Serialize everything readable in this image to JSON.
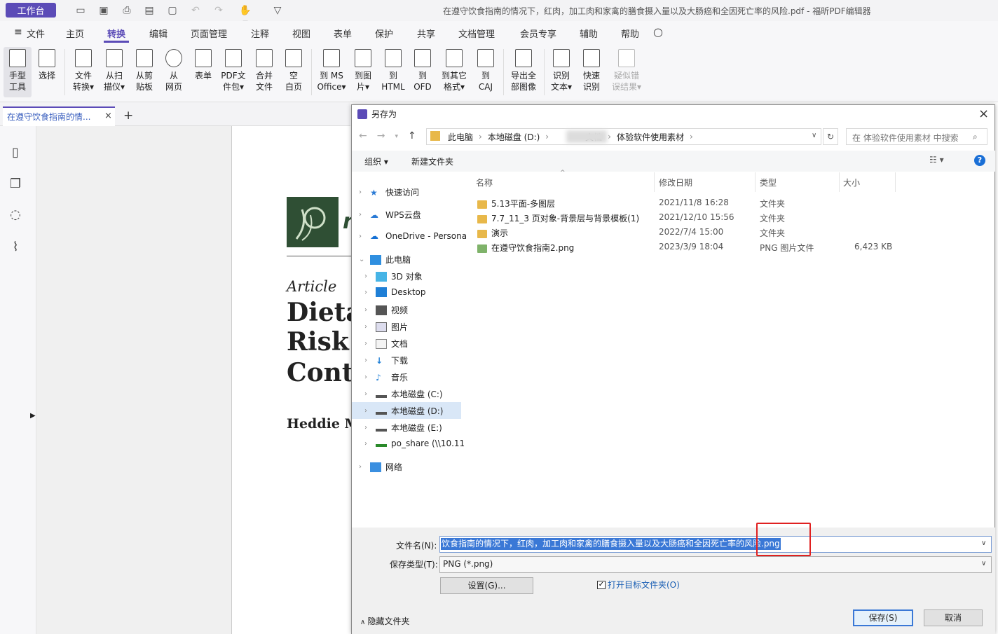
{
  "titlebar": {
    "workbench": "工作台",
    "doc_title": "在遵守饮食指南的情况下，红肉，加工肉和家禽的膳食摄入量以及大肠癌和全因死亡率的风险.pdf - 福昕PDF编辑器"
  },
  "menu": [
    "文件",
    "主页",
    "转换",
    "编辑",
    "页面管理",
    "注释",
    "视图",
    "表单",
    "保护",
    "共享",
    "文档管理",
    "会员专享",
    "辅助",
    "帮助"
  ],
  "ribbon": [
    {
      "label": "手型\n工具"
    },
    {
      "label": "选择"
    },
    {
      "label": "文件\n转换▾"
    },
    {
      "label": "从扫\n描仪▾"
    },
    {
      "label": "从剪\n贴板"
    },
    {
      "label": "从\n网页"
    },
    {
      "label": "表单"
    },
    {
      "label": "PDF文\n件包▾"
    },
    {
      "label": "合并\n文件"
    },
    {
      "label": "空\n白页"
    },
    {
      "label": "到 MS\nOffice▾"
    },
    {
      "label": "到图\n片▾"
    },
    {
      "label": "到\nHTML"
    },
    {
      "label": "到\nOFD"
    },
    {
      "label": "到其它\n格式▾"
    },
    {
      "label": "到\nCAJ"
    },
    {
      "label": "导出全\n部图像"
    },
    {
      "label": "识别\n文本▾"
    },
    {
      "label": "快速\n识别"
    },
    {
      "label": "疑似错\n误结果▾"
    }
  ],
  "tab": {
    "label": "在遵守饮食指南的情..."
  },
  "pdf": {
    "article": "Article",
    "line1": "Dieta",
    "line2": "Risk",
    "line3": "Conte",
    "author": "Heddie M"
  },
  "dialog": {
    "title": "另存为",
    "breadcrumb": [
      "此电脑",
      "本地磁盘 (D:)",
      "文档",
      "体验软件使用素材"
    ],
    "search_placeholder": "在 体验软件使用素材 中搜索",
    "organize": "组织 ▾",
    "new_folder": "新建文件夹",
    "nav": [
      {
        "label": "快速访问",
        "icon": "star"
      },
      {
        "label": "WPS云盘",
        "icon": "cloud"
      },
      {
        "label": "OneDrive - Persona",
        "icon": "onedrive"
      },
      {
        "label": "此电脑",
        "icon": "pc"
      },
      {
        "label": "3D 对象",
        "icon": "cube"
      },
      {
        "label": "Desktop",
        "icon": "desktop"
      },
      {
        "label": "视频",
        "icon": "video"
      },
      {
        "label": "图片",
        "icon": "picture"
      },
      {
        "label": "文档",
        "icon": "doc"
      },
      {
        "label": "下载",
        "icon": "download"
      },
      {
        "label": "音乐",
        "icon": "music"
      },
      {
        "label": "本地磁盘 (C:)",
        "icon": "drive"
      },
      {
        "label": "本地磁盘 (D:)",
        "icon": "drive"
      },
      {
        "label": "本地磁盘 (E:)",
        "icon": "drive"
      },
      {
        "label": "po_share (\\\\10.11",
        "icon": "netdrive"
      },
      {
        "label": "网络",
        "icon": "network"
      }
    ],
    "columns": {
      "name": "名称",
      "date": "修改日期",
      "type": "类型",
      "size": "大小"
    },
    "files": [
      {
        "name": "5.13平面-多图层",
        "date": "2021/11/8 16:28",
        "type": "文件夹",
        "size": ""
      },
      {
        "name": "7.7_11_3 页对象-背景层与背景模板(1)",
        "date": "2021/12/10 15:56",
        "type": "文件夹",
        "size": ""
      },
      {
        "name": "演示",
        "date": "2022/7/4 15:00",
        "type": "文件夹",
        "size": ""
      },
      {
        "name": "在遵守饮食指南2.png",
        "date": "2023/3/9 18:04",
        "type": "PNG 图片文件",
        "size": "6,423 KB"
      }
    ],
    "filename_label": "文件名(N):",
    "filename_value": "饮食指南的情况下，红肉，加工肉和家禽的膳食摄入量以及大肠癌和全因死亡率的风险.png",
    "type_label": "保存类型(T):",
    "type_value": "PNG (*.png)",
    "settings": "设置(G)...",
    "open_folder": "打开目标文件夹(O)",
    "hide_folders": "隐藏文件夹",
    "save": "保存(S)",
    "cancel": "取消"
  }
}
